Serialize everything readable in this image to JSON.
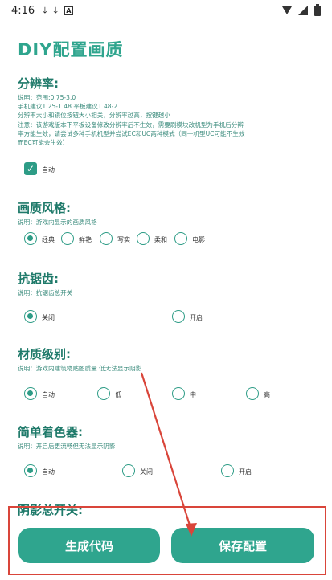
{
  "status_bar": {
    "time": "4:16",
    "app_icon_letter": "A"
  },
  "title": "DIY配置画质",
  "sections": {
    "resolution": {
      "title": "分辨率:",
      "desc_lines": [
        "说明：范围:0.75-3.0",
        "手机建议1.25-1.48  平板建议1.48-2",
        "分辨率大小和镜位按钮大小相关，分辨率越高，按键越小",
        "注意：该游戏版本下平板设备修改分辨率后不生效，需要刷模块改机型为手机后分辨",
        "率方能生效，请尝试多种手机机型并尝试EC和UC两种模式（同一机型UC可能不生效",
        "而EC可能会生效）"
      ],
      "checkbox_label": "自动"
    },
    "quality_style": {
      "title": "画质风格:",
      "desc": "说明：游戏内显示的画质风格",
      "options": [
        "经典",
        "鲜艳",
        "写实",
        "柔和",
        "电影"
      ]
    },
    "antialias": {
      "title": "抗锯齿:",
      "desc": "说明：抗锯齿总开关",
      "options": [
        "关闭",
        "开启"
      ]
    },
    "material": {
      "title": "材质级别:",
      "desc": "说明：游戏内建筑物贴图质量 低无法显示阴影",
      "options": [
        "自动",
        "低",
        "中",
        "高"
      ]
    },
    "shader": {
      "title": "简单着色器:",
      "desc": "说明：开启后更流畅但无法显示阴影",
      "options": [
        "自动",
        "关闭",
        "开启"
      ]
    },
    "shadow": {
      "title": "阴影总开关:"
    }
  },
  "buttons": {
    "generate": "生成代码",
    "save": "保存配置"
  },
  "colors": {
    "accent": "#2fa58e",
    "annotation": "#d9453a"
  }
}
